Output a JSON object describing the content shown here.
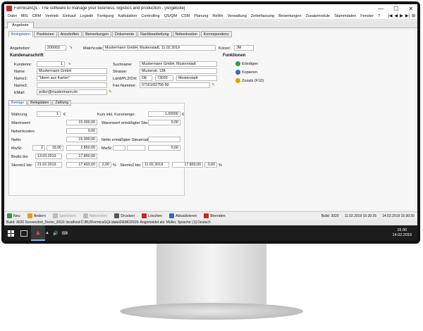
{
  "window": {
    "title": "FormicaSQL - The software to manage your business, logistics and production - [Angebote]",
    "minimize": "—",
    "maximize": "☐",
    "close": "✕"
  },
  "menu": {
    "items": [
      "Datei",
      "MIS",
      "CRM",
      "Vertrieb",
      "Einkauf",
      "Logistik",
      "Fertigung",
      "Kalkulation",
      "Controlling",
      "QS/QM",
      "CSM",
      "Planung",
      "ReWe",
      "Verwaltung",
      "Zeiterfassung",
      "Bewertungen",
      "Zusatzmodule",
      "Stammdaten",
      "Fenster",
      "?"
    ],
    "right": [
      "|◀",
      "◀",
      "▶",
      "▶|",
      "⊞"
    ]
  },
  "doc_tab": "Angebote",
  "tabs": [
    "Belegdaten",
    "Positionen",
    "Anschriften",
    "Bemerkungen",
    "Dokumente",
    "Nachbearbeitung",
    "Nebenkosten",
    "Korrespondenz"
  ],
  "header": {
    "angebotsnr_label": "Angebotsnr:",
    "angebotsnr": "200003",
    "matchcode_label": "Matchcode:",
    "matchcode": "Mustermann GmbH, Musterstadt, 11.02.2019",
    "kuerzel_label": "Kürzel:",
    "kuerzel": "JM"
  },
  "kunde": {
    "section": "Kundenanschrift",
    "kundennr_label": "Kundennr:",
    "kundennr": "1",
    "name_label": "Name:",
    "name": "Mustermann GmbH",
    "name1_label": "Name1:",
    "name1": "\"Ideen aus Karton\"",
    "name2_label": "Name2:",
    "name2": "",
    "email_label": "EMail:",
    "email": "poller@mustermann.de",
    "suchname_label": "Suchname:",
    "suchname": "Mustermann GmbH, Musterstadt",
    "strasse_label": "Strasse:",
    "strasse": "Musterstr. 138",
    "land_label": "Land/PLZ/Ort:",
    "land": "DE",
    "plz": "73033",
    "ort": "Musterstadt",
    "fax_label": "Fax-Nummer:",
    "fax": "07161/02756-50"
  },
  "funktionen": {
    "title": "Funktionen",
    "items": [
      "Erledigen",
      "Kopieren",
      "Zusatz (F10)"
    ]
  },
  "inner_tabs": [
    "Beträge",
    "Belegdaten",
    "Zahlung"
  ],
  "betraege": {
    "waehrung_label": "Währung:",
    "waehrung": "1",
    "waehrung_sym": "€",
    "kurs_label": "Kurs inkl. Kursmenge:",
    "kurs": "1,00000",
    "kurs_sym": "€",
    "warenwert_label": "Warenwert:",
    "warenwert": "15.000,00",
    "warenwert_erm_label": "Warenwert ermäßigter Steuersatz:",
    "warenwert_erm": "0,00",
    "nebenkosten_label": "Nebenkosten:",
    "nebenkosten": "0,00",
    "netto_label": "Netto:",
    "netto": "15.000,00",
    "netto_erm_label": "Netto ermäßigter Steuersatz:",
    "netto_erm": "",
    "mwst_label": "MwSt:",
    "mwst_code": "2",
    "mwst_satz": "19,00",
    "mwst_betrag": "2.850,00",
    "mwst2_label": "MwSt:",
    "mwst2_betrag": "0,00",
    "brutto_label": "Brutto bis:",
    "brutto_datum": "13.03.2019",
    "brutto": "17.850,00",
    "skonto1_label": "Skonto1 bis:",
    "skonto1_datum": "21.02.2019",
    "skonto1_betrag": "17.493,00",
    "skonto1_pct": "2,00",
    "skonto2_label": "Skonto2 bis:",
    "skonto2_datum": "11.02.2019",
    "skonto2_betrag": "17.850,00",
    "skonto2_pct": "0,00",
    "pct_sym": "%"
  },
  "toolbar": {
    "new": "Neu",
    "edit": "Ändern",
    "save": "Speichern",
    "cancel": "Abbrechen",
    "print": "Drucken",
    "delete": "Löschen",
    "refresh": "Aktualisieren",
    "close": "Beenden",
    "info1": "Build: 3020",
    "info2": "11.02.2019 15:30:35",
    "info3": "14.02.2019 15:30:35"
  },
  "status": "Build: 3020     Screenshot_Demo_2019: localhost:C:\\BU\\FormicaSQL\\data\\DEMO2019:   Angemeldet als: Müller, Sprache: [1] Deutsch",
  "taskbar": {
    "time": "15:30",
    "date": "14.02.2019",
    "tray": [
      "▲",
      "🔊",
      "⌨"
    ]
  },
  "colors": {
    "accent": "#1f4f9e",
    "new": "#2e9e3a",
    "delete": "#c62828"
  }
}
